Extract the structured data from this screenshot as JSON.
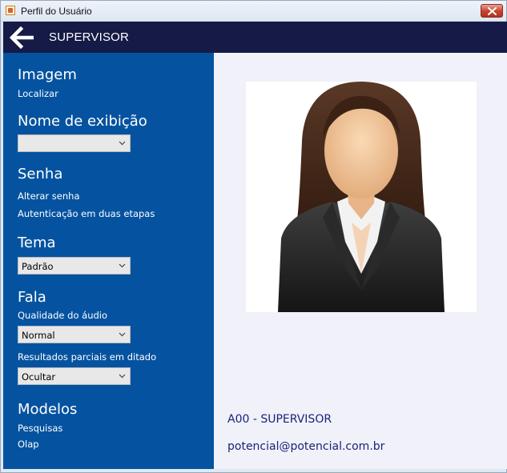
{
  "window": {
    "title": "Perfil do Usuário"
  },
  "header": {
    "title": "SUPERVISOR"
  },
  "sidebar": {
    "imagem": {
      "heading": "Imagem",
      "link": "Localizar"
    },
    "nome": {
      "heading": "Nome de exibição",
      "value": ""
    },
    "senha": {
      "heading": "Senha",
      "links": [
        "Alterar senha",
        "Autenticação em duas etapas"
      ]
    },
    "tema": {
      "heading": "Tema",
      "value": "Padrão"
    },
    "fala": {
      "heading": "Fala",
      "quality_label": "Qualidade do áudio",
      "quality_value": "Normal",
      "partial_label": "Resultados parciais em ditado",
      "partial_value": "Ocultar"
    },
    "modelos": {
      "heading": "Modelos",
      "links": [
        "Pesquisas",
        "Olap"
      ]
    }
  },
  "profile": {
    "user_id": "A00 - SUPERVISOR",
    "email": "potencial@potencial.com.br"
  },
  "colors": {
    "header_bg": "#151a46",
    "sidebar_bg": "#0553a0",
    "main_bg": "#f1f1f9",
    "profile_text": "#1b237a"
  },
  "icons": {
    "back": "arrow-left-icon",
    "close": "close-icon",
    "app": "app-icon",
    "dropdown": "chevron-down-icon",
    "avatar": "female-user-avatar"
  }
}
